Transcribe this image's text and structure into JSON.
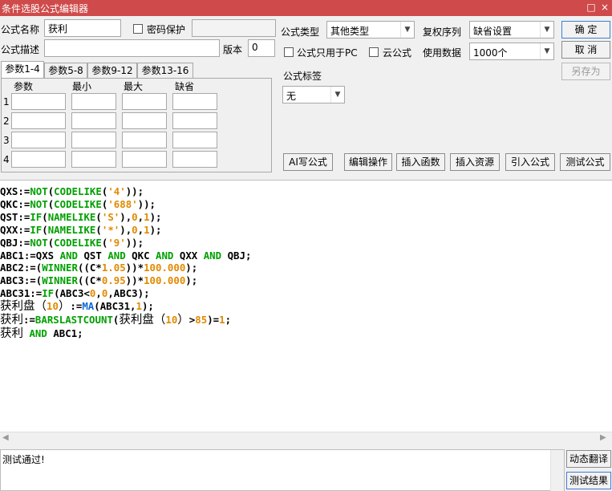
{
  "window": {
    "title": "条件选股公式编辑器",
    "minimize_glyph": "□",
    "close_glyph": "×"
  },
  "form": {
    "name_label": "公式名称",
    "name_value": "获利",
    "password_label": "密码保护",
    "desc_label": "公式描述",
    "desc_value": "",
    "version_label": "版本",
    "version_value": "0",
    "type_label": "公式类型",
    "type_value": "其他类型",
    "restore_label": "复权序列",
    "restore_value": "缺省设置",
    "pc_only_label": "公式只用于PC",
    "cloud_label": "云公式",
    "usage_label": "使用数据",
    "usage_value": "1000个",
    "tag_label": "公式标签",
    "tag_value": "无"
  },
  "buttons": {
    "ok": "确 定",
    "cancel": "取 消",
    "save_as": "另存为",
    "ai_write": "AI写公式",
    "edit_ops": "编辑操作",
    "insert_func": "插入函数",
    "insert_res": "插入资源",
    "import_formula": "引入公式",
    "test_formula": "测试公式",
    "dynamic_translate": "动态翻译",
    "test_result": "测试结果"
  },
  "tabs": [
    "参数1-4",
    "参数5-8",
    "参数9-12",
    "参数13-16"
  ],
  "param_headers": [
    "参数",
    "最小",
    "最大",
    "缺省"
  ],
  "param_rows": [
    "1",
    "2",
    "3",
    "4"
  ],
  "code": {
    "line1": "QXS:=NOT(CODELIKE('4'));",
    "line2": "QKC:=NOT(CODELIKE('688'));",
    "line3": "QST:=IF(NAMELIKE('S'),0,1);",
    "line4": "QXX:=IF(NAMELIKE('*'),0,1);",
    "line5": "QBJ:=NOT(CODELIKE('9'));",
    "line6": "ABC1:=QXS AND QST AND QKC AND QXX AND QBJ;",
    "line7": "ABC2:=(WINNER((C*1.05))*100.000);",
    "line8": "ABC3:=(WINNER((C*0.95))*100.000);",
    "line9": "ABC31:=IF(ABC3<0,0,ABC3);",
    "line10": "获利盘（10）:=MA(ABC31,1);",
    "line11": "获利:=BARSLASTCOUNT(获利盘（10）>85)=1;",
    "line12": "获利 AND ABC1;"
  },
  "status": {
    "message": "测试通过!"
  }
}
